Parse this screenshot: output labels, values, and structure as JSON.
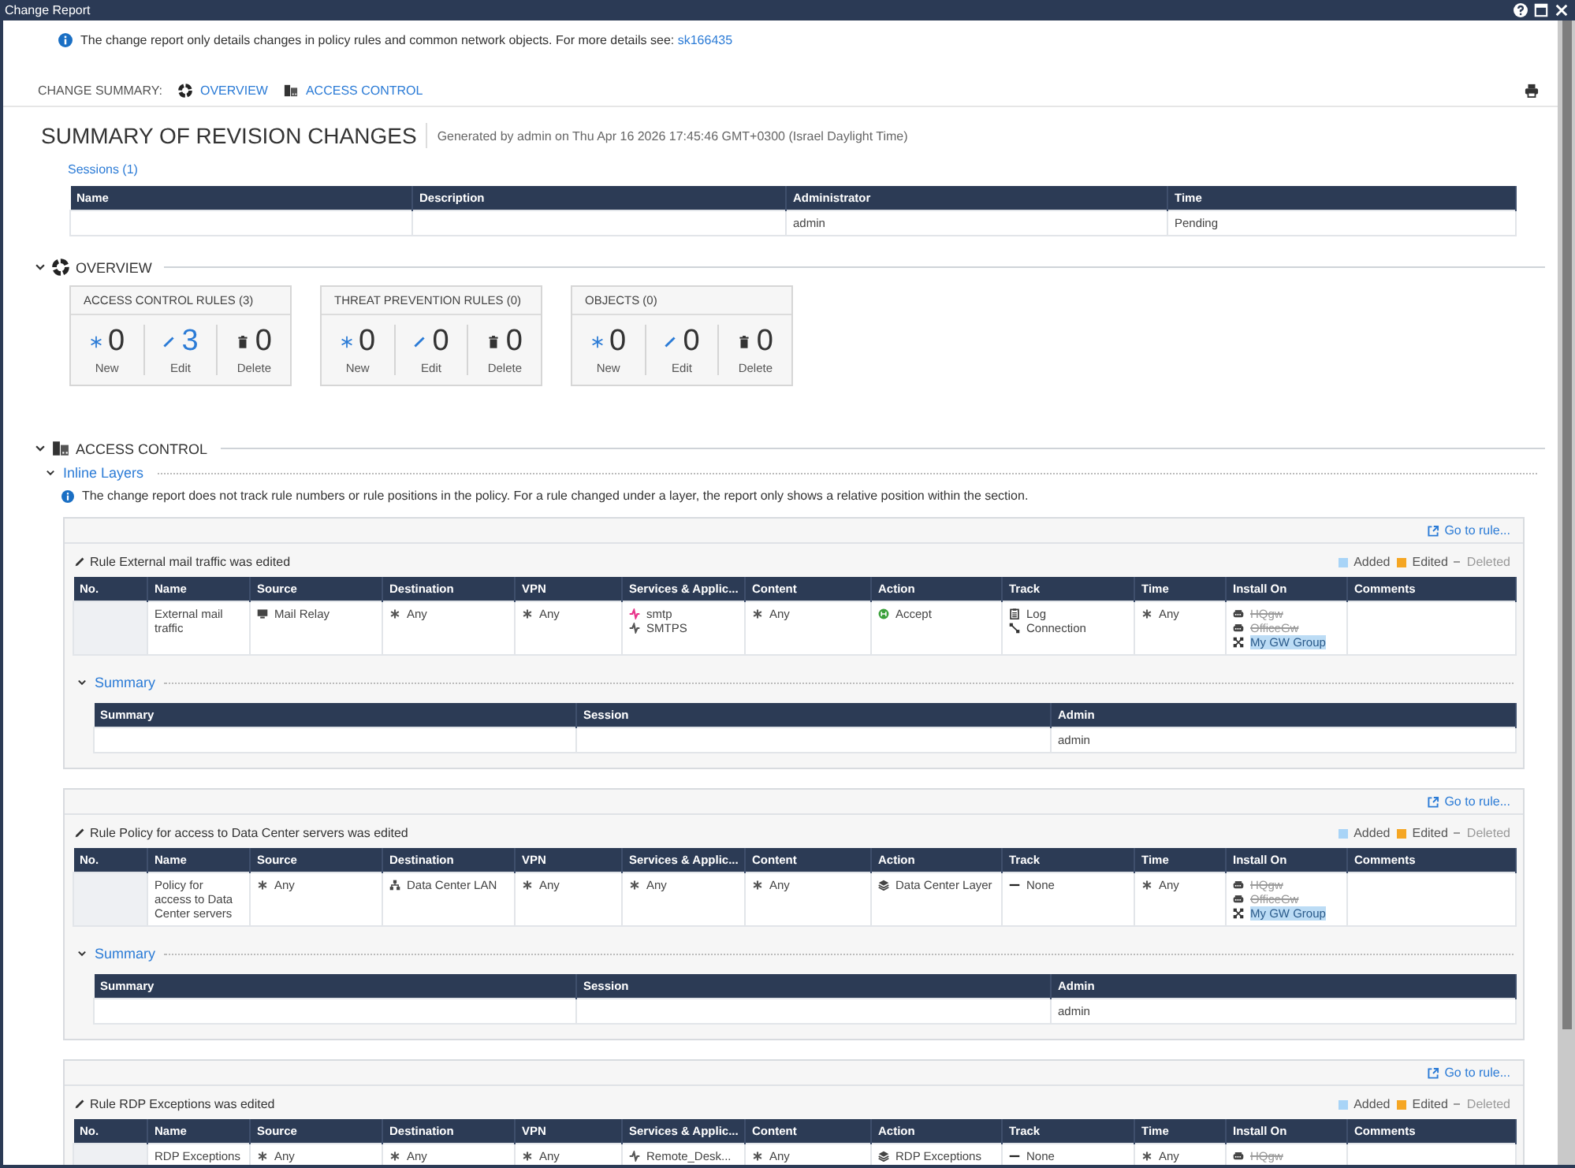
{
  "window": {
    "title": "Change Report"
  },
  "notice": {
    "text": "The change report only details changes in policy rules and common network objects. For more details see:",
    "link": "sk166435"
  },
  "change_summary": {
    "label": "CHANGE SUMMARY:",
    "links": [
      {
        "kind": "overview",
        "label": "OVERVIEW"
      },
      {
        "kind": "access",
        "label": "ACCESS CONTROL"
      }
    ]
  },
  "header": {
    "title": "SUMMARY OF REVISION CHANGES",
    "generated": "Generated by admin on Thu Apr 16 2026 17:45:46 GMT+0300 (Israel Daylight Time)"
  },
  "sessions": {
    "label": "Sessions (1)",
    "columns": [
      "Name",
      "Description",
      "Administrator",
      "Time"
    ],
    "rows": [
      [
        null,
        null,
        "admin",
        "Pending"
      ]
    ]
  },
  "overview": {
    "title": "OVERVIEW",
    "expanded": true,
    "cards": [
      {
        "title": "ACCESS CONTROL RULES (3)",
        "stats": [
          {
            "kind": "new",
            "value": "0",
            "label": "New",
            "highlighted": false
          },
          {
            "kind": "edit",
            "value": "3",
            "label": "Edit",
            "highlighted": true
          },
          {
            "kind": "delete",
            "value": "0",
            "label": "Delete",
            "highlighted": false
          }
        ]
      },
      {
        "title": "THREAT PREVENTION RULES (0)",
        "stats": [
          {
            "kind": "new",
            "value": "0",
            "label": "New",
            "highlighted": false
          },
          {
            "kind": "edit",
            "value": "0",
            "label": "Edit",
            "highlighted": false
          },
          {
            "kind": "delete",
            "value": "0",
            "label": "Delete",
            "highlighted": false
          }
        ]
      },
      {
        "title": "OBJECTS (0)",
        "stats": [
          {
            "kind": "new",
            "value": "0",
            "label": "New",
            "highlighted": false
          },
          {
            "kind": "edit",
            "value": "0",
            "label": "Edit",
            "highlighted": false
          },
          {
            "kind": "delete",
            "value": "0",
            "label": "Delete",
            "highlighted": false
          }
        ]
      }
    ]
  },
  "access_control": {
    "title": "ACCESS CONTROL",
    "expanded": true,
    "inline_layers": {
      "title": "Inline Layers",
      "expanded": true
    },
    "note": "The change report does not track rule numbers or rule positions in the policy. For a rule changed under a layer, the report only shows a relative position within the section.",
    "rules": [
      {
        "goto": "Go to rule...",
        "heading": "Rule External mail traffic was edited",
        "legend": [
          {
            "kind": "added",
            "label": "Added",
            "color": "#a8d4f7"
          },
          {
            "kind": "edited",
            "label": "Edited",
            "color": "#f5a623"
          },
          {
            "kind": "deleted",
            "label": "Deleted"
          }
        ],
        "columns": [
          "No.",
          "Name",
          "Source",
          "Destination",
          "VPN",
          "Services & Applic...",
          "Content",
          "Action",
          "Track",
          "Time",
          "Install On",
          "Comments"
        ],
        "cells": [
          null,
          [
            {
              "text": "External mail traffic"
            }
          ],
          [
            {
              "kind": "host",
              "text": "Mail Relay"
            }
          ],
          [
            {
              "kind": "any",
              "text": "Any"
            }
          ],
          [
            {
              "kind": "any",
              "text": "Any"
            }
          ],
          [
            {
              "kind": "service",
              "color": "#e8338a",
              "text": "smtp"
            },
            {
              "kind": "service",
              "color": "#555555",
              "text": "SMTPS"
            }
          ],
          [
            {
              "kind": "any",
              "text": "Any"
            }
          ],
          [
            {
              "kind": "accept",
              "text": "Accept"
            }
          ],
          [
            {
              "kind": "log",
              "text": "Log"
            },
            {
              "kind": "connection",
              "text": "Connection"
            }
          ],
          [
            {
              "kind": "any",
              "text": "Any"
            }
          ],
          [
            {
              "kind": "gateway",
              "text": "HQgw",
              "deleted": true,
              "added": false
            },
            {
              "kind": "gateway",
              "text": "OfficeGw",
              "deleted": true,
              "added": false
            },
            {
              "kind": "group",
              "text": "My GW Group",
              "deleted": false,
              "added": true
            }
          ],
          null
        ],
        "summary": {
          "title": "Summary",
          "expanded": true,
          "columns": [
            "Summary",
            "Session",
            "Admin"
          ],
          "rows": [
            [
              null,
              null,
              "admin"
            ]
          ]
        }
      },
      {
        "goto": "Go to rule...",
        "heading": "Rule Policy for access to Data Center servers was edited",
        "legend": [
          {
            "kind": "added",
            "label": "Added",
            "color": "#a8d4f7"
          },
          {
            "kind": "edited",
            "label": "Edited",
            "color": "#f5a623"
          },
          {
            "kind": "deleted",
            "label": "Deleted"
          }
        ],
        "columns": [
          "No.",
          "Name",
          "Source",
          "Destination",
          "VPN",
          "Services & Applic...",
          "Content",
          "Action",
          "Track",
          "Time",
          "Install On",
          "Comments"
        ],
        "cells": [
          null,
          [
            {
              "text": "Policy for access to Data Center servers"
            }
          ],
          [
            {
              "kind": "any",
              "text": "Any"
            }
          ],
          [
            {
              "kind": "network",
              "text": "Data Center LAN"
            }
          ],
          [
            {
              "kind": "any",
              "text": "Any"
            }
          ],
          [
            {
              "kind": "any",
              "text": "Any"
            }
          ],
          [
            {
              "kind": "any",
              "text": "Any"
            }
          ],
          [
            {
              "kind": "layer",
              "text": "Data Center Layer"
            }
          ],
          [
            {
              "kind": "none",
              "text": "None"
            }
          ],
          [
            {
              "kind": "any",
              "text": "Any"
            }
          ],
          [
            {
              "kind": "gateway",
              "text": "HQgw",
              "deleted": true,
              "added": false
            },
            {
              "kind": "gateway",
              "text": "OfficeGw",
              "deleted": true,
              "added": false
            },
            {
              "kind": "group",
              "text": "My GW Group",
              "deleted": false,
              "added": true
            }
          ],
          null
        ],
        "summary": {
          "title": "Summary",
          "expanded": true,
          "columns": [
            "Summary",
            "Session",
            "Admin"
          ],
          "rows": [
            [
              null,
              null,
              "admin"
            ]
          ]
        }
      },
      {
        "goto": "Go to rule...",
        "heading": "Rule RDP Exceptions was edited",
        "legend": [
          {
            "kind": "added",
            "label": "Added",
            "color": "#a8d4f7"
          },
          {
            "kind": "edited",
            "label": "Edited",
            "color": "#f5a623"
          },
          {
            "kind": "deleted",
            "label": "Deleted"
          }
        ],
        "columns": [
          "No.",
          "Name",
          "Source",
          "Destination",
          "VPN",
          "Services & Applic...",
          "Content",
          "Action",
          "Track",
          "Time",
          "Install On",
          "Comments"
        ],
        "cells": [
          null,
          [
            {
              "text": "RDP Exceptions"
            }
          ],
          [
            {
              "kind": "any",
              "text": "Any"
            }
          ],
          [
            {
              "kind": "any",
              "text": "Any"
            }
          ],
          [
            {
              "kind": "any",
              "text": "Any"
            }
          ],
          [
            {
              "kind": "service",
              "color": "#555555",
              "text": "Remote_Desk..."
            }
          ],
          [
            {
              "kind": "any",
              "text": "Any"
            }
          ],
          [
            {
              "kind": "layer",
              "text": "RDP Exceptions"
            }
          ],
          [
            {
              "kind": "none",
              "text": "None"
            }
          ],
          [
            {
              "kind": "any",
              "text": "Any"
            }
          ],
          [
            {
              "kind": "gateway",
              "text": "HQgw",
              "deleted": true,
              "added": false
            }
          ],
          null
        ]
      }
    ]
  }
}
